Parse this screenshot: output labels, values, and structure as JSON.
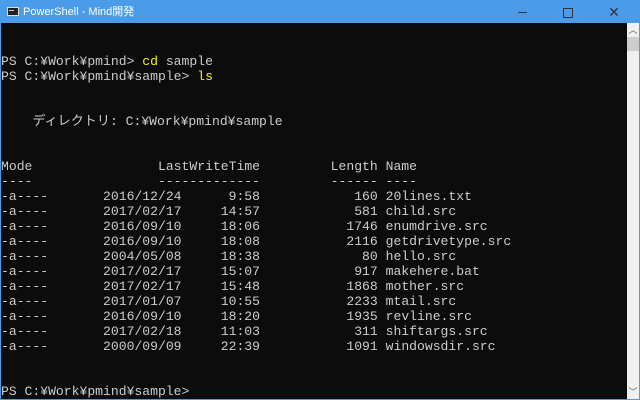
{
  "window": {
    "title": "PowerShell - Mind開発",
    "minimize": "—",
    "maximize": "□",
    "close": "✕"
  },
  "console": {
    "prompt1": "PS C:¥Work¥pmind> ",
    "cmd1_name": "cd",
    "cmd1_arg": " sample",
    "prompt2": "PS C:¥Work¥pmind¥sample> ",
    "cmd2_name": "ls",
    "directory_line": "    ディレクトリ: C:¥Work¥pmind¥sample",
    "headers": {
      "mode": "Mode",
      "time": "LastWriteTime",
      "length": "Length",
      "name": "Name"
    },
    "rows": [
      {
        "mode": "-a----",
        "date": "2016/12/24",
        "time": "9:58",
        "length": "160",
        "name": "20lines.txt"
      },
      {
        "mode": "-a----",
        "date": "2017/02/17",
        "time": "14:57",
        "length": "581",
        "name": "child.src"
      },
      {
        "mode": "-a----",
        "date": "2016/09/10",
        "time": "18:06",
        "length": "1746",
        "name": "enumdrive.src"
      },
      {
        "mode": "-a----",
        "date": "2016/09/10",
        "time": "18:08",
        "length": "2116",
        "name": "getdrivetype.src"
      },
      {
        "mode": "-a----",
        "date": "2004/05/08",
        "time": "18:38",
        "length": "80",
        "name": "hello.src"
      },
      {
        "mode": "-a----",
        "date": "2017/02/17",
        "time": "15:07",
        "length": "917",
        "name": "makehere.bat"
      },
      {
        "mode": "-a----",
        "date": "2017/02/17",
        "time": "15:48",
        "length": "1868",
        "name": "mother.src"
      },
      {
        "mode": "-a----",
        "date": "2017/01/07",
        "time": "10:55",
        "length": "2233",
        "name": "mtail.src"
      },
      {
        "mode": "-a----",
        "date": "2016/09/10",
        "time": "18:20",
        "length": "1935",
        "name": "revline.src"
      },
      {
        "mode": "-a----",
        "date": "2017/02/18",
        "time": "11:03",
        "length": "311",
        "name": "shiftargs.src"
      },
      {
        "mode": "-a----",
        "date": "2000/09/09",
        "time": "22:39",
        "length": "1091",
        "name": "windowsdir.src"
      }
    ],
    "final_prompt": "PS C:¥Work¥pmind¥sample> "
  }
}
